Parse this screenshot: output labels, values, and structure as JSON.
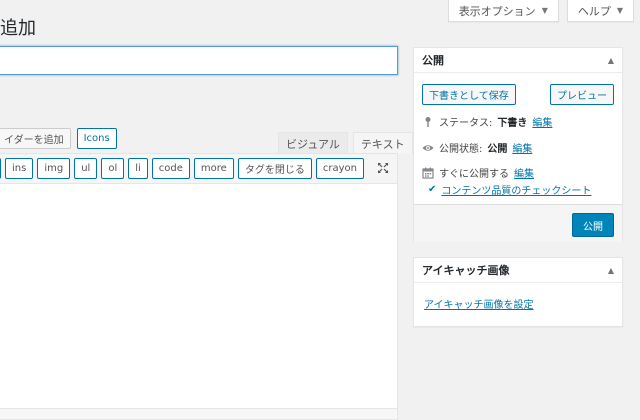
{
  "screen_meta": {
    "screen_options": "表示オプション",
    "help": "ヘルプ"
  },
  "page_title": "追加",
  "title_input": {
    "value": "",
    "placeholder": ""
  },
  "media_buttons": [
    {
      "label": "イダーを追加"
    },
    {
      "label": "Icons"
    }
  ],
  "editor_tabs": {
    "visual": "ビジュアル",
    "text": "テキスト"
  },
  "quicktags": [
    "",
    "ins",
    "img",
    "ul",
    "ol",
    "li",
    "code",
    "more",
    "タグを閉じる",
    "crayon"
  ],
  "publish": {
    "title": "公開",
    "save_draft": "下書きとして保存",
    "preview": "プレビュー",
    "status_label": "ステータス:",
    "status_value": "下書き",
    "visibility_label": "公開状態:",
    "visibility_value": "公開",
    "schedule_label": "すぐに公開する",
    "edit": "編集",
    "checklist_link": "コンテンツ品質のチェックシート",
    "publish_button": "公開"
  },
  "featured_image": {
    "title": "アイキャッチ画像",
    "set_link": "アイキャッチ画像を設定"
  },
  "colors": {
    "accent": "#0073aa",
    "primary": "#0085ba"
  }
}
